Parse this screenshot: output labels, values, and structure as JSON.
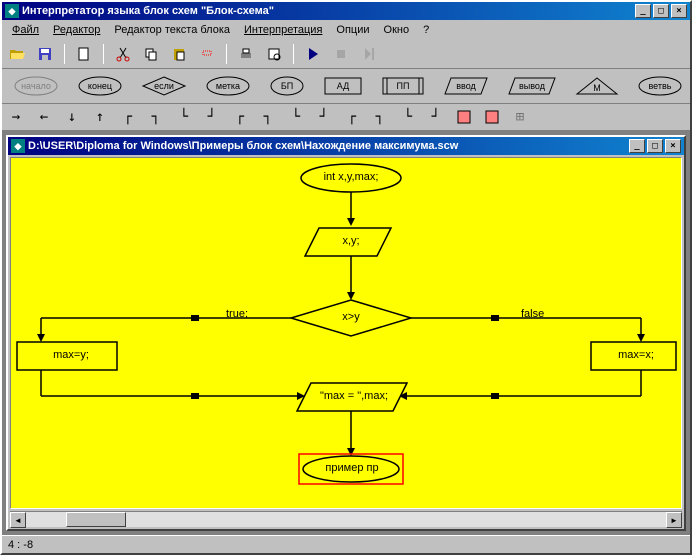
{
  "window": {
    "title": "Интерпретатор языка блок схем \"Блок-схема\""
  },
  "menu": {
    "file": "Файл",
    "editor": "Редактор",
    "text_editor": "Редактор текста блока",
    "interpretation": "Интерпретация",
    "options": "Опции",
    "window": "Окно",
    "help": "?"
  },
  "shapes": {
    "start": "начало",
    "end": "конец",
    "if": "если",
    "label": "метка",
    "bp": "БП",
    "ad": "АД",
    "pp": "ПП",
    "input": "ввод",
    "output": "вывод",
    "m": "М",
    "branch": "ветвь"
  },
  "child": {
    "title": "D:\\USER\\Diploma for Windows\\Примеры блок схем\\Нахождение максимума.scw"
  },
  "flowchart": {
    "n1": "int x,y,max;",
    "n2": "x,y;",
    "n3": "x>y",
    "n4": "max=y;",
    "n5": "max=x;",
    "n6": "\"max = \",max;",
    "n7": "пример пр",
    "lbl_true": "true;",
    "lbl_false": "false"
  },
  "status": {
    "coords": "4 : -8"
  }
}
